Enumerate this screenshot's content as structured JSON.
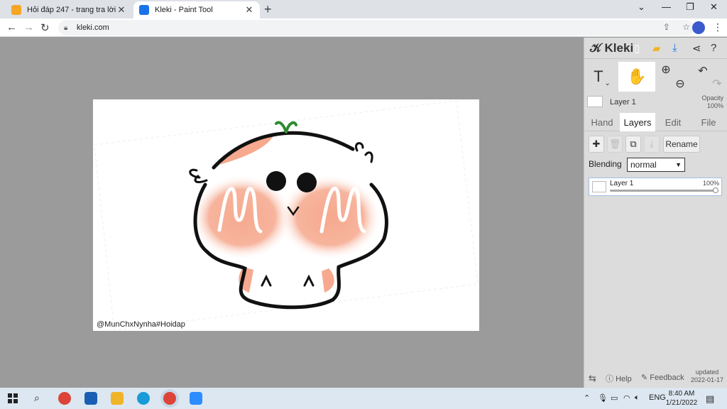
{
  "browser": {
    "tabs": [
      {
        "title": "Hỏi đáp 247 - trang tra lời",
        "favicon_color": "#f5a623"
      },
      {
        "title": "Kleki - Paint Tool",
        "favicon_color": "#1a73e8"
      }
    ],
    "url": "kleki.com",
    "new_tab_glyph": "+",
    "close_glyph": "✕"
  },
  "canvas": {
    "watermark": "@MunChxNynha#Hoidap",
    "colors": {
      "outline": "#111111",
      "blush": "#f6a98e",
      "sprout": "#2e8b2e"
    }
  },
  "panel": {
    "brand": "Kleki",
    "opacity_label": "Opacity",
    "opacity_value": "100%",
    "current_layer": "Layer 1",
    "tabs": [
      "Hand",
      "Layers",
      "Edit",
      "File"
    ],
    "active_tab": "Layers",
    "rename_label": "Rename",
    "blending_label": "Blending",
    "blending_value": "normal",
    "layers": [
      {
        "name": "Layer 1",
        "opacity_text": "100%",
        "opacity": 1.0
      }
    ],
    "footer": {
      "help": "Help",
      "feedback": "Feedback",
      "updated_label": "updated",
      "updated_date": "2022-01-17"
    }
  },
  "taskbar": {
    "language": "ENG",
    "time": "8:40 AM",
    "date": "1/21/2022"
  }
}
